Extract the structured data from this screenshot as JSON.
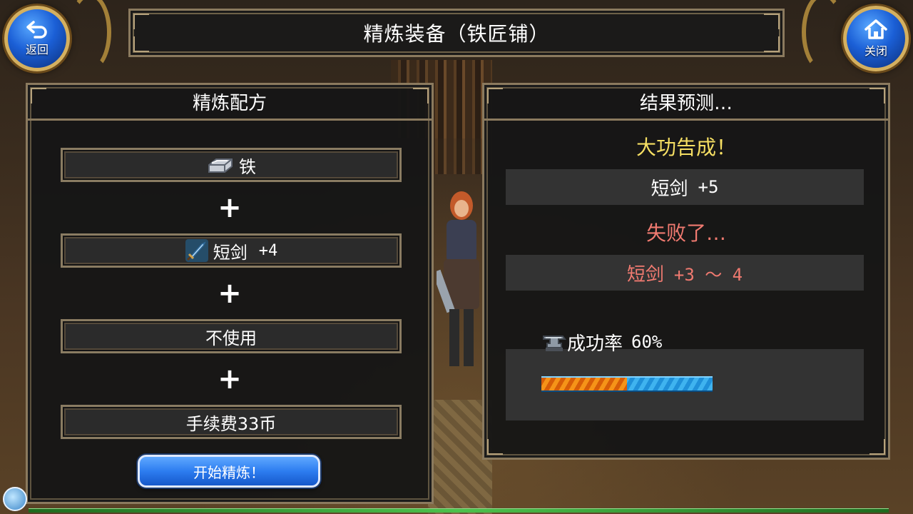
{
  "title": "精炼装备（铁匠铺）",
  "nav": {
    "back_label": "返回",
    "close_label": "关闭"
  },
  "recipe": {
    "header": "精炼配方",
    "material": "铁",
    "equipment_name": "短剑",
    "equipment_level": "+4",
    "option": "不使用",
    "fee": "手续费33币",
    "plus_symbol": "+",
    "start_label": "开始精炼！"
  },
  "result": {
    "header": "结果预测…",
    "success_text": "大功告成！",
    "success_item": "短剑",
    "success_level": "+5",
    "fail_text": "失败了…",
    "fail_item": "短剑",
    "fail_range": "+3 ～ 4",
    "rate_label": "成功率",
    "rate_value": "60%",
    "rate_fraction": 0.5
  },
  "colors": {
    "success": "#f6df63",
    "fail": "#f07a70",
    "frame": "#8b7a5e",
    "button_blue": "#2d7df0"
  },
  "icons": {
    "back": "back-arrow-icon",
    "close": "home-icon",
    "material": "iron-ingot-icon",
    "equipment": "sword-icon",
    "rate": "anvil-icon"
  }
}
